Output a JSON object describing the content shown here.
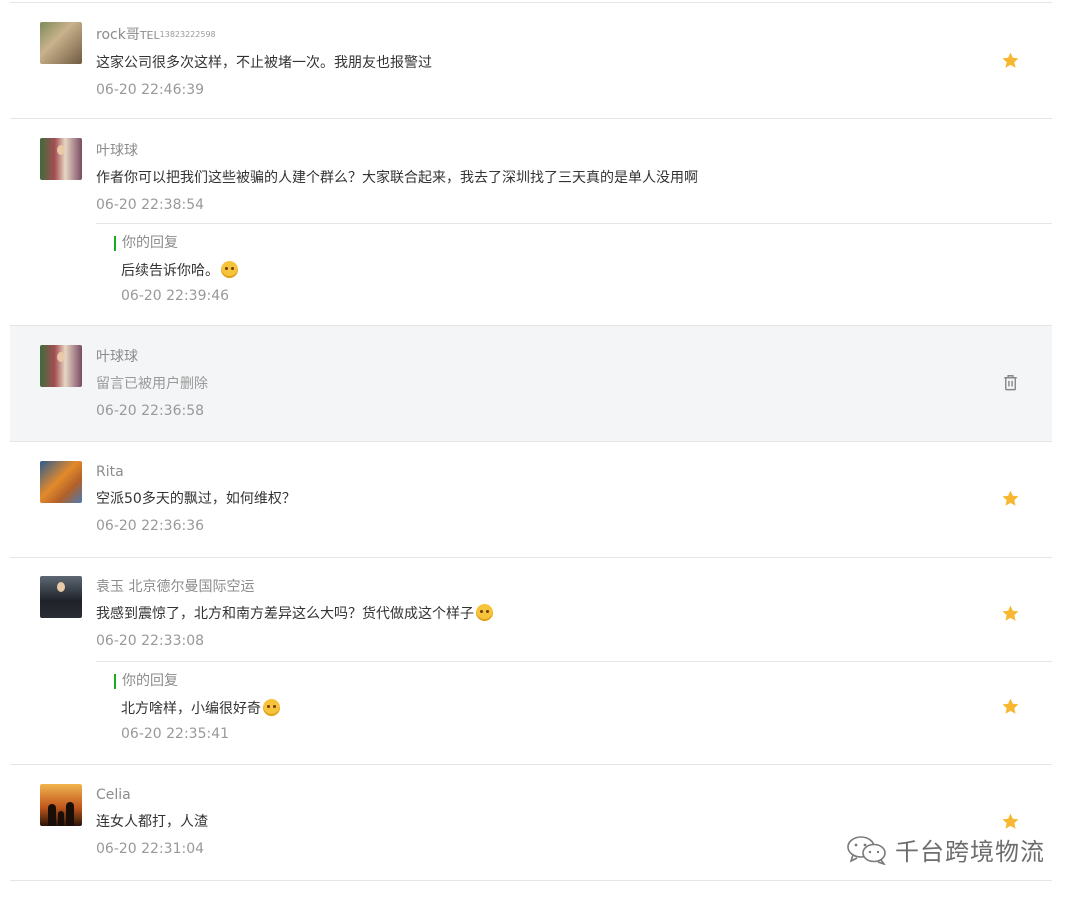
{
  "comments": [
    {
      "nickname": "rock哥",
      "nickname_tag": "TEL",
      "nickname_sup": "13823222598",
      "content": "这家公司很多次这样，不止被堵一次。我朋友也报警过",
      "time": "06-20 22:46:39",
      "action_icon": "star-icon"
    },
    {
      "nickname": "叶球球",
      "content": "作者你可以把我们这些被骗的人建个群么？大家联合起来，我去了深圳找了三天真的是单人没用啊",
      "time": "06-20 22:38:54",
      "reply": {
        "label": "你的回复",
        "content": "后续告诉你哈。",
        "emoji": "smile-emoji",
        "time": "06-20 22:39:46"
      }
    },
    {
      "nickname": "叶球球",
      "content": "留言已被用户删除",
      "time": "06-20 22:36:58",
      "deleted": true,
      "action_icon": "trash-icon"
    },
    {
      "nickname": "Rita",
      "content": "空派50多天的飘过，如何维权？",
      "time": "06-20 22:36:36",
      "action_icon": "star-icon"
    },
    {
      "nickname": "袁玉 北京德尔曼国际空运",
      "content": "我感到震惊了，北方和南方差异这么大吗？货代做成这个样子",
      "emoji": "pleading-emoji",
      "time": "06-20 22:33:08",
      "action_icon": "star-icon",
      "reply": {
        "label": "你的回复",
        "content": "北方啥样，小编很好奇",
        "emoji": "heart-eyes-emoji",
        "time": "06-20 22:35:41"
      }
    },
    {
      "nickname": "Celia",
      "content": "连女人都打，人渣",
      "time": "06-20 22:31:04",
      "action_icon": "star-icon"
    }
  ],
  "watermark": {
    "text": "千台跨境物流",
    "icon": "wechat-icon"
  },
  "colors": {
    "star": "#f7b731",
    "reply_bar": "#1aad19",
    "deleted_bg": "#f4f5f7"
  }
}
